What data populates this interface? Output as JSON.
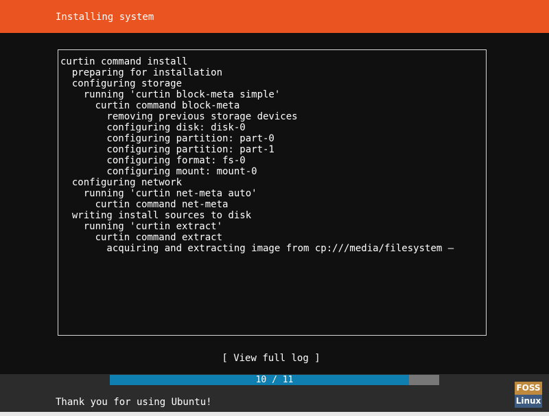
{
  "header": {
    "title": "Installing system"
  },
  "log": {
    "lines": [
      "curtin command install",
      "  preparing for installation",
      "  configuring storage",
      "    running 'curtin block-meta simple'",
      "      curtin command block-meta",
      "        removing previous storage devices",
      "        configuring disk: disk-0",
      "        configuring partition: part-0",
      "        configuring partition: part-1",
      "        configuring format: fs-0",
      "        configuring mount: mount-0",
      "  configuring network",
      "    running 'curtin net-meta auto'",
      "      curtin command net-meta",
      "  writing install sources to disk",
      "    running 'curtin extract'",
      "      curtin command extract",
      "        acquiring and extracting image from cp:///media/filesystem –"
    ]
  },
  "actions": {
    "view_full_log": "[ View full log ]"
  },
  "progress": {
    "label": "10 / 11",
    "current": 10,
    "total": 11,
    "fill_color": "#0e7fb0",
    "track_color": "#777777"
  },
  "footer": {
    "message": "Thank you for using Ubuntu!"
  },
  "watermark": {
    "top": "FOSS",
    "bottom": "Linux"
  },
  "colors": {
    "header": "#e95420",
    "background": "#101010"
  }
}
